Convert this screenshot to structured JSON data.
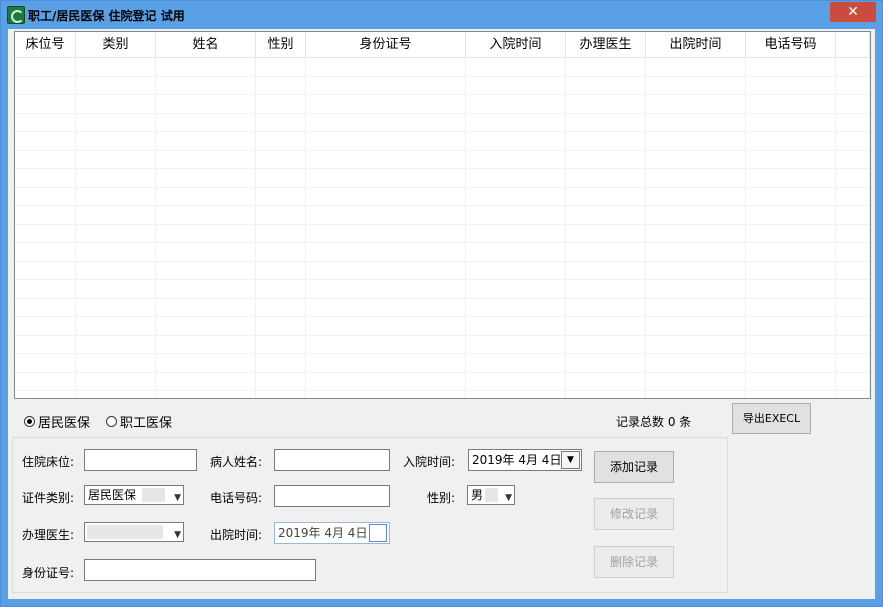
{
  "window": {
    "title": "职工/居民医保 住院登记 试用",
    "close_label": "✕"
  },
  "grid": {
    "columns": [
      "床位号",
      "类别",
      "姓名",
      "性别",
      "身份证号",
      "入院时间",
      "办理医生",
      "出院时间",
      "电话号码"
    ],
    "rows": []
  },
  "insurance_type": {
    "options": [
      "居民医保",
      "职工医保"
    ],
    "selected": "居民医保"
  },
  "record_count": "记录总数 0 条",
  "export_button": "导出EXECL",
  "form": {
    "bed_label": "住院床位:",
    "bed_value": "",
    "patient_name_label": "病人姓名:",
    "patient_name_value": "",
    "admit_time_label": "入院时间:",
    "admit_time_value": "2019年 4月 4日",
    "id_type_label": "证件类别:",
    "id_type_value": "居民医保",
    "phone_label": "电话号码:",
    "phone_value": "",
    "gender_label": "性别:",
    "gender_value": "男",
    "doctor_label": "办理医生:",
    "doctor_value": "",
    "discharge_time_label": "出院时间:",
    "discharge_time_value": "2019年 4月 4日",
    "id_number_label": "身份证号:",
    "id_number_value": ""
  },
  "buttons": {
    "add": "添加记录",
    "modify": "修改记录",
    "delete": "删除记录"
  }
}
